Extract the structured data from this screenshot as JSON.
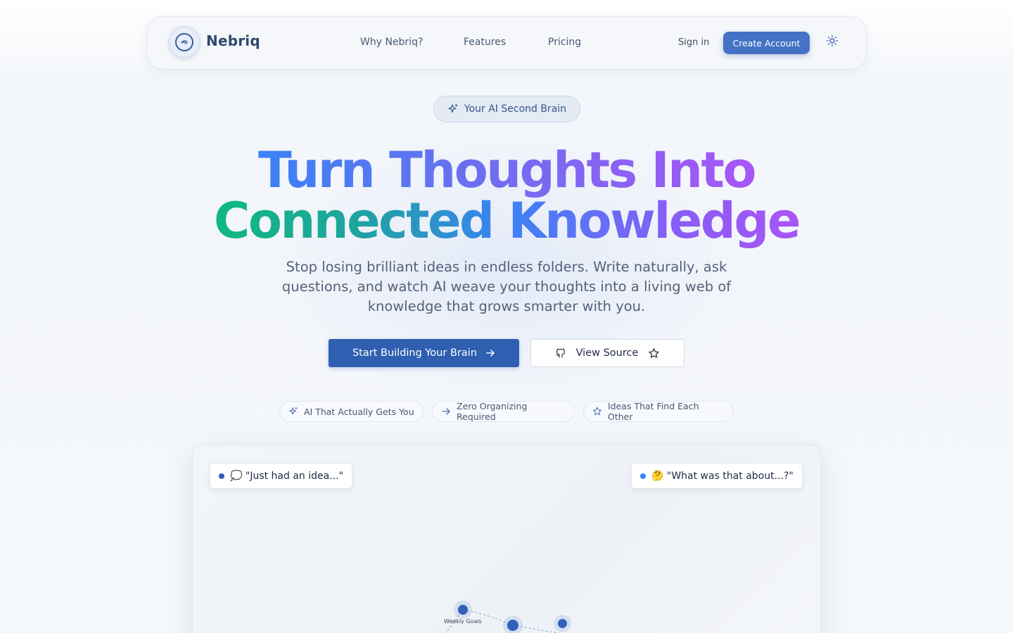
{
  "header": {
    "brand": "Nebriq",
    "nav": [
      "Why Nebriq?",
      "Features",
      "Pricing"
    ],
    "signin_label": "Sign in",
    "create_account_label": "Create Account",
    "theme_icon": "sun-icon",
    "logo_icon": "brain-logo-icon"
  },
  "hero": {
    "badge": "Your AI Second Brain",
    "badge_icon": "sparkles-icon",
    "headline_line1": "Turn Thoughts Into",
    "headline_line2": "Connected Knowledge",
    "subtitle": "Stop losing brilliant ideas in endless folders. Write naturally, ask questions, and watch AI weave your thoughts into a living web of knowledge that grows smarter with you.",
    "primary_cta": "Start Building Your Brain",
    "primary_cta_icon": "arrow-right-icon",
    "secondary_cta": "View Source",
    "secondary_cta_icons": [
      "github-icon",
      "star-icon"
    ]
  },
  "features": [
    {
      "label": "AI That Actually Gets You",
      "icon": "sparkles-icon"
    },
    {
      "label": "Zero Organizing Required",
      "icon": "arrow-right-icon"
    },
    {
      "label": "Ideas That Find Each Other",
      "icon": "star-icon"
    }
  ],
  "demo": {
    "chip_left": "💭 \"Just had an idea...\"",
    "chip_right": "🤔 \"What was that about...?\"",
    "node_label": "Weekly Goals"
  },
  "colors": {
    "accent": "#4472c4",
    "primary_button": "#2f5fb0",
    "gradient_blue": "#3b82f6",
    "gradient_purple": "#a855f7",
    "gradient_green": "#10b981"
  }
}
